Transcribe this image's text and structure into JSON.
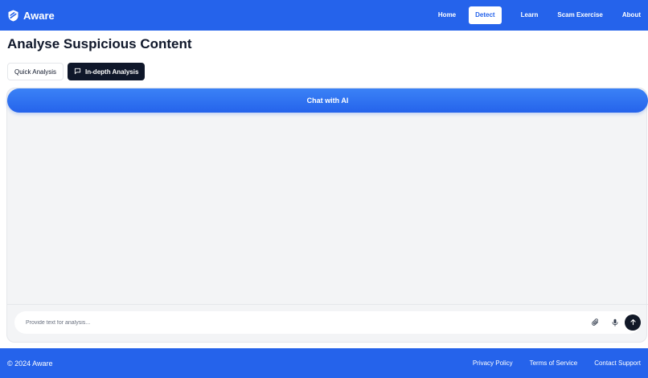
{
  "header": {
    "brand": "Aware",
    "logo_icon": "shield-logo-icon",
    "nav": [
      {
        "label": "Home",
        "active": false
      },
      {
        "label": "Detect",
        "active": true
      },
      {
        "label": "Learn",
        "active": false
      },
      {
        "label": "Scam Exercise",
        "active": false
      },
      {
        "label": "About",
        "active": false
      }
    ]
  },
  "main": {
    "title": "Analyse Suspicious Content",
    "tabs": [
      {
        "label": "Quick Analysis",
        "active": false
      },
      {
        "label": "In-depth Analysis",
        "active": true,
        "icon": "message-square-icon"
      }
    ],
    "chat": {
      "title": "Chat with AI",
      "input_placeholder": "Provide text for analysis...",
      "input_value": "",
      "buttons": [
        "paperclip-icon",
        "microphone-icon",
        "arrow-up-icon"
      ]
    }
  },
  "footer": {
    "copyright": "© 2024 Aware",
    "links": [
      "Privacy Policy",
      "Terms of Service",
      "Contact Support"
    ]
  },
  "colors": {
    "primary": "#2563eb",
    "dark": "#0f172a",
    "panel_bg": "#f3f4f6"
  }
}
